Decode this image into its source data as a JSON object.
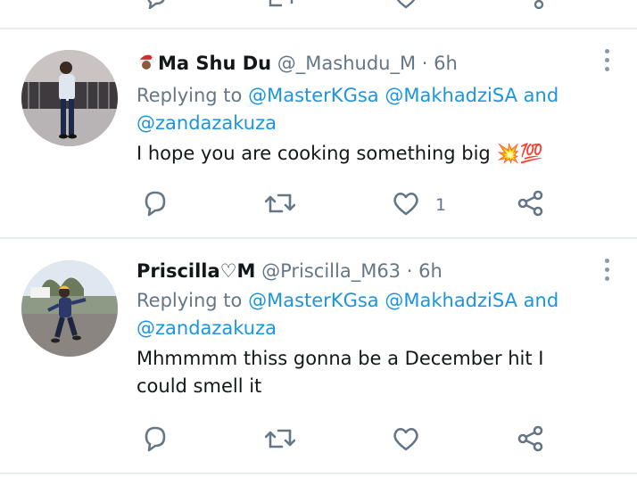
{
  "tweets": [
    {
      "name": "Ma Shu Du",
      "handle": "@_Mashudu_M",
      "separator": "·",
      "time": "6h",
      "reply_prefix": "Replying to",
      "mention_1": "@MasterKGsa",
      "mention_2": "@MakhadziSA",
      "reply_and": "and",
      "mention_3": "@zandazakuza",
      "text": "I hope you are cooking something big",
      "text_emoji": "💥💯",
      "like_count": "1"
    },
    {
      "name": "Priscilla♡M",
      "handle": "@Priscilla_M63",
      "separator": "·",
      "time": "6h",
      "reply_prefix": "Replying to",
      "mention_1": "@MasterKGsa",
      "mention_2": "@MakhadziSA",
      "reply_and": "and",
      "mention_3": "@zandazakuza",
      "text": "Mhmmmm thiss gonna be a December hit I could smell it",
      "like_count": ""
    }
  ],
  "icons": {
    "reply": "comment-bubble-icon",
    "retweet": "retweet-icon",
    "like": "heart-icon",
    "share": "share-icon",
    "more": "more-vertical-icon",
    "santa": "santa-emoji-icon"
  },
  "colors": {
    "mention": "#1b95e0",
    "secondary_text": "#657786",
    "divider": "#e6ecf0",
    "icon": "#657786"
  }
}
